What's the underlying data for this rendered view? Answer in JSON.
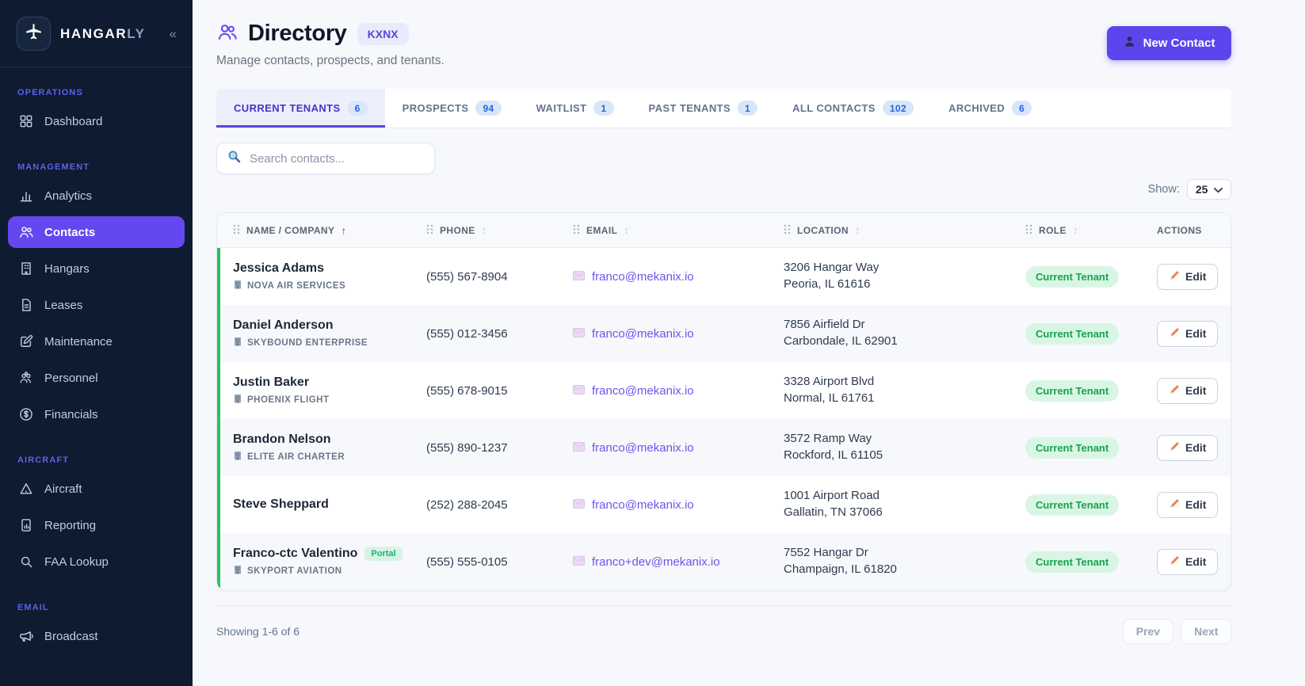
{
  "app": {
    "name_primary": "HANGAR",
    "name_secondary": "LY",
    "collapse_icon": "«"
  },
  "sidebar": {
    "sections": [
      {
        "label": "OPERATIONS",
        "items": [
          {
            "label": "Dashboard",
            "icon": "dashboard-grid-icon",
            "active": false
          }
        ]
      },
      {
        "label": "MANAGEMENT",
        "items": [
          {
            "label": "Analytics",
            "icon": "bar-chart-icon",
            "active": false
          },
          {
            "label": "Contacts",
            "icon": "people-icon",
            "active": true
          },
          {
            "label": "Hangars",
            "icon": "building-icon",
            "active": false
          },
          {
            "label": "Leases",
            "icon": "document-icon",
            "active": false
          },
          {
            "label": "Maintenance",
            "icon": "pencil-square-icon",
            "active": false
          },
          {
            "label": "Personnel",
            "icon": "group-icon",
            "active": false
          },
          {
            "label": "Financials",
            "icon": "dollar-circle-icon",
            "active": false
          }
        ]
      },
      {
        "label": "AIRCRAFT",
        "items": [
          {
            "label": "Aircraft",
            "icon": "triangle-icon",
            "active": false
          },
          {
            "label": "Reporting",
            "icon": "report-doc-icon",
            "active": false
          },
          {
            "label": "FAA Lookup",
            "icon": "search-glass-icon",
            "active": false
          }
        ]
      },
      {
        "label": "EMAIL",
        "items": [
          {
            "label": "Broadcast",
            "icon": "megaphone-icon",
            "active": false
          }
        ]
      }
    ]
  },
  "header": {
    "title": "Directory",
    "badge": "KXNX",
    "subtitle": "Manage contacts, prospects, and tenants.",
    "new_contact_label": "New Contact"
  },
  "tabs": [
    {
      "label": "CURRENT TENANTS",
      "count": "6",
      "active": true
    },
    {
      "label": "PROSPECTS",
      "count": "94",
      "active": false
    },
    {
      "label": "WAITLIST",
      "count": "1",
      "active": false
    },
    {
      "label": "PAST TENANTS",
      "count": "1",
      "active": false
    },
    {
      "label": "ALL CONTACTS",
      "count": "102",
      "active": false
    },
    {
      "label": "ARCHIVED",
      "count": "6",
      "active": false
    }
  ],
  "toolbar": {
    "search_placeholder": "Search contacts...",
    "show_label": "Show:",
    "show_value": "25"
  },
  "table": {
    "edit_label": "Edit",
    "columns": [
      {
        "label": "NAME / COMPANY",
        "sort": "asc",
        "handle": true
      },
      {
        "label": "PHONE",
        "sort": "both",
        "handle": true
      },
      {
        "label": "EMAIL",
        "sort": "both",
        "handle": true
      },
      {
        "label": "LOCATION",
        "sort": "both",
        "handle": true
      },
      {
        "label": "ROLE",
        "sort": "both",
        "handle": true
      },
      {
        "label": "ACTIONS",
        "sort": "none",
        "handle": false
      }
    ],
    "rows": [
      {
        "name": "Jessica Adams",
        "portal": false,
        "company": "NOVA AIR SERVICES",
        "phone": "(555) 567-8904",
        "email": "franco@mekanix.io",
        "address1": "3206 Hangar Way",
        "address2": "Peoria, IL 61616",
        "role": "Current Tenant"
      },
      {
        "name": "Daniel Anderson",
        "portal": false,
        "company": "SKYBOUND ENTERPRISE",
        "phone": "(555) 012-3456",
        "email": "franco@mekanix.io",
        "address1": "7856 Airfield Dr",
        "address2": "Carbondale, IL 62901",
        "role": "Current Tenant"
      },
      {
        "name": "Justin Baker",
        "portal": false,
        "company": "PHOENIX FLIGHT",
        "phone": "(555) 678-9015",
        "email": "franco@mekanix.io",
        "address1": "3328 Airport Blvd",
        "address2": "Normal, IL 61761",
        "role": "Current Tenant"
      },
      {
        "name": "Brandon Nelson",
        "portal": false,
        "company": "ELITE AIR CHARTER",
        "phone": "(555) 890-1237",
        "email": "franco@mekanix.io",
        "address1": "3572 Ramp Way",
        "address2": "Rockford, IL 61105",
        "role": "Current Tenant"
      },
      {
        "name": "Steve Sheppard",
        "portal": false,
        "company": "",
        "phone": "(252) 288-2045",
        "email": "franco@mekanix.io",
        "address1": "1001 Airport Road",
        "address2": "Gallatin, TN 37066",
        "role": "Current Tenant"
      },
      {
        "name": "Franco-ctc Valentino",
        "portal": true,
        "portal_label": "Portal",
        "company": "SKYPORT AVIATION",
        "phone": "(555) 555-0105",
        "email": "franco+dev@mekanix.io",
        "address1": "7552 Hangar Dr",
        "address2": "Champaign, IL 61820",
        "role": "Current Tenant"
      }
    ]
  },
  "footer": {
    "summary": "Showing 1-6 of 6",
    "prev": "Prev",
    "next": "Next"
  },
  "colors": {
    "accent_purple": "#5b46ee",
    "nav_active_purple": "#6348f0",
    "tenant_green_bar": "#22c55e",
    "role_badge_bg": "#d9f6e5",
    "role_badge_text": "#17a24c",
    "count_badge_bg": "#d8e6fb",
    "count_badge_text": "#2a66d6",
    "sidebar_bg": "#0e1b31"
  }
}
